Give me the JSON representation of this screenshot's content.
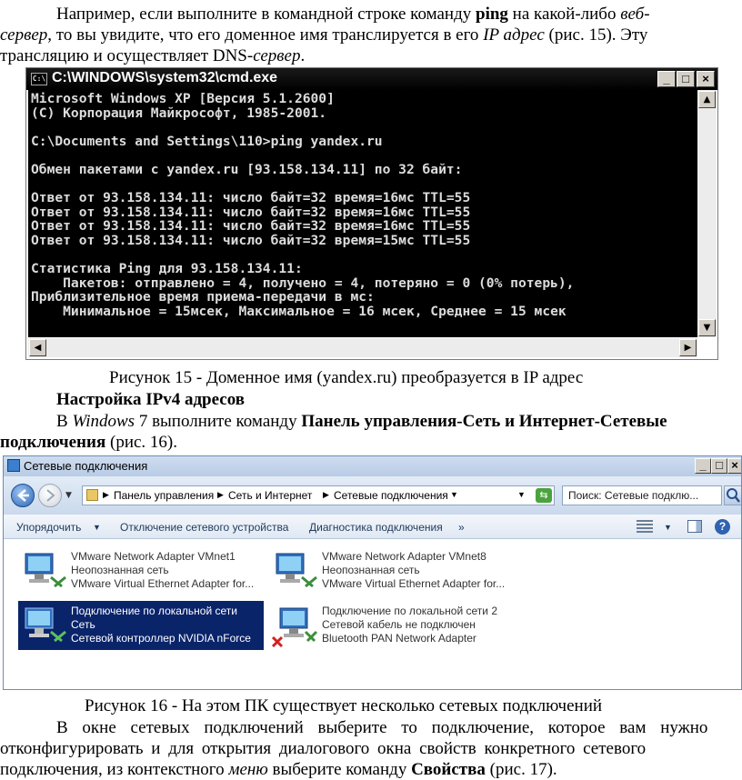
{
  "para1": {
    "l1a": "Например, если выполните в командной строке команду ",
    "l1b": "ping",
    "l1c": " на какой-либо ",
    "l1d": "веб-",
    "l2a": "сервер",
    "l2b": ", то вы увидите, что его доменное имя транслируется в его ",
    "l2c": "IP адрес",
    "l2d": " (рис. 15). Эту",
    "l3a": "трансляцию и осуществляет DNS-",
    "l3b": "сервер",
    "l3c": "."
  },
  "cmd": {
    "title": "C:\\WINDOWS\\system32\\cmd.exe",
    "icon": "C:\\",
    "lines": [
      "Microsoft Windows XP [Версия 5.1.2600]",
      "(С) Корпорация Майкрософт, 1985-2001.",
      "",
      "C:\\Documents and Settings\\110>ping yandex.ru",
      "",
      "Обмен пакетами с yandex.ru [93.158.134.11] по 32 байт:",
      "",
      "Ответ от 93.158.134.11: число байт=32 время=16мс TTL=55",
      "Ответ от 93.158.134.11: число байт=32 время=16мс TTL=55",
      "Ответ от 93.158.134.11: число байт=32 время=16мс TTL=55",
      "Ответ от 93.158.134.11: число байт=32 время=15мс TTL=55",
      "",
      "Статистика Ping для 93.158.134.11:",
      "    Пакетов: отправлено = 4, получено = 4, потеряно = 0 (0% потерь),",
      "Приблизительное время приема-передачи в мс:",
      "    Минимальное = 15мсек, Максимальное = 16 мсек, Среднее = 15 мсек"
    ]
  },
  "caption15": "Рисунок 15 - Доменное имя (yandex.ru) преобразуется в IP адрес",
  "heading": "Настройка IPv4 адресов",
  "para2": {
    "a": "В ",
    "b": "Windows",
    "c": " 7 выполните команду ",
    "d": "Панель управления-Сеть и Интернет-Сетевые",
    "e": "подключения",
    "f": " (рис. 16)."
  },
  "net": {
    "title": "Сетевые подключения",
    "breadcrumb": [
      "Панель управления",
      "Сеть и Интернет",
      "Сетевые подключения"
    ],
    "search_placeholder": "Поиск: Сетевые подклю...",
    "toolbar": [
      "Упорядочить",
      "Отключение сетевого устройства",
      "Диагностика подключения",
      "»"
    ],
    "items": [
      {
        "name": "VMware Network Adapter VMnet1",
        "status": "Неопознанная сеть",
        "device": "VMware Virtual Ethernet Adapter for..."
      },
      {
        "name": "VMware Network Adapter VMnet8",
        "status": "Неопознанная сеть",
        "device": "VMware Virtual Ethernet Adapter for..."
      },
      {
        "name": "Подключение по локальной сети",
        "status": "Сеть",
        "device": "Сетевой контроллер NVIDIA nForce"
      },
      {
        "name": "Подключение по локальной сети 2",
        "status": "Сетевой кабель не подключен",
        "device": "Bluetooth PAN Network Adapter"
      }
    ]
  },
  "caption16": "Рисунок 16 - На этом ПК существует несколько сетевых подключений",
  "para3": {
    "l1": "В окне сетевых подключений выберите то подключение, которое вам нужно",
    "l2": "отконфигурировать и для открытия диалогового окна свойств конкретного сетевого",
    "l3a": "подключения, из контекстного ",
    "l3b": "меню",
    "l3c": " выберите команду ",
    "l3d": "Свойства",
    "l3e": " (рис. 17)."
  }
}
